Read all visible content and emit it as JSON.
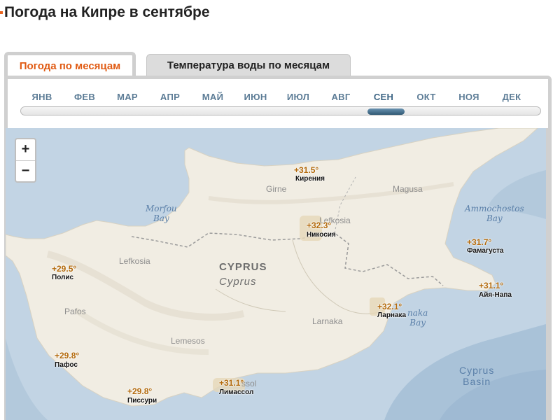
{
  "page": {
    "title": "Погода на Кипре в сентябре"
  },
  "tabs": [
    {
      "label": "Погода по месяцам",
      "active": true
    },
    {
      "label": "Температура воды по месяцам",
      "active": false
    }
  ],
  "months": [
    "ЯНВ",
    "ФЕВ",
    "МАР",
    "АПР",
    "МАЙ",
    "ИЮН",
    "ИЮЛ",
    "АВГ",
    "СЕН",
    "ОКТ",
    "НОЯ",
    "ДЕК"
  ],
  "selected_month": "СЕН",
  "zoom": {
    "in": "+",
    "out": "−"
  },
  "map": {
    "country": "CYPRUS",
    "country_local": "Cyprus",
    "water_labels": [
      "Morfou",
      "Bay",
      "Ammochostos",
      "Bay",
      "naka",
      "Bay",
      "Cyprus",
      "Basin"
    ],
    "place_labels": [
      "Girne",
      "Magusa",
      "Lefkosia",
      "Lefkosia",
      "Pafos",
      "Larnaka",
      "Lemesos",
      "ssol"
    ],
    "markers": [
      {
        "city": "Кирения",
        "temp": "+31.5°"
      },
      {
        "city": "Никосия",
        "temp": "+32.3°"
      },
      {
        "city": "Фамагуста",
        "temp": "+31.7°"
      },
      {
        "city": "Полис",
        "temp": "+29.5°"
      },
      {
        "city": "Айя-Напа",
        "temp": "+31.1°"
      },
      {
        "city": "Ларнака",
        "temp": "+32.1°"
      },
      {
        "city": "Пафос",
        "temp": "+29.8°"
      },
      {
        "city": "Писсури",
        "temp": "+29.8°"
      },
      {
        "city": "Лимассол",
        "temp": "+31.1°"
      }
    ]
  },
  "colors": {
    "accent": "#e05a12",
    "month_text": "#5c7c96",
    "sea": "#c2d4e4",
    "deep_sea": "#9fbad3",
    "land": "#f1ede3",
    "temp_text": "#b36a0c"
  }
}
